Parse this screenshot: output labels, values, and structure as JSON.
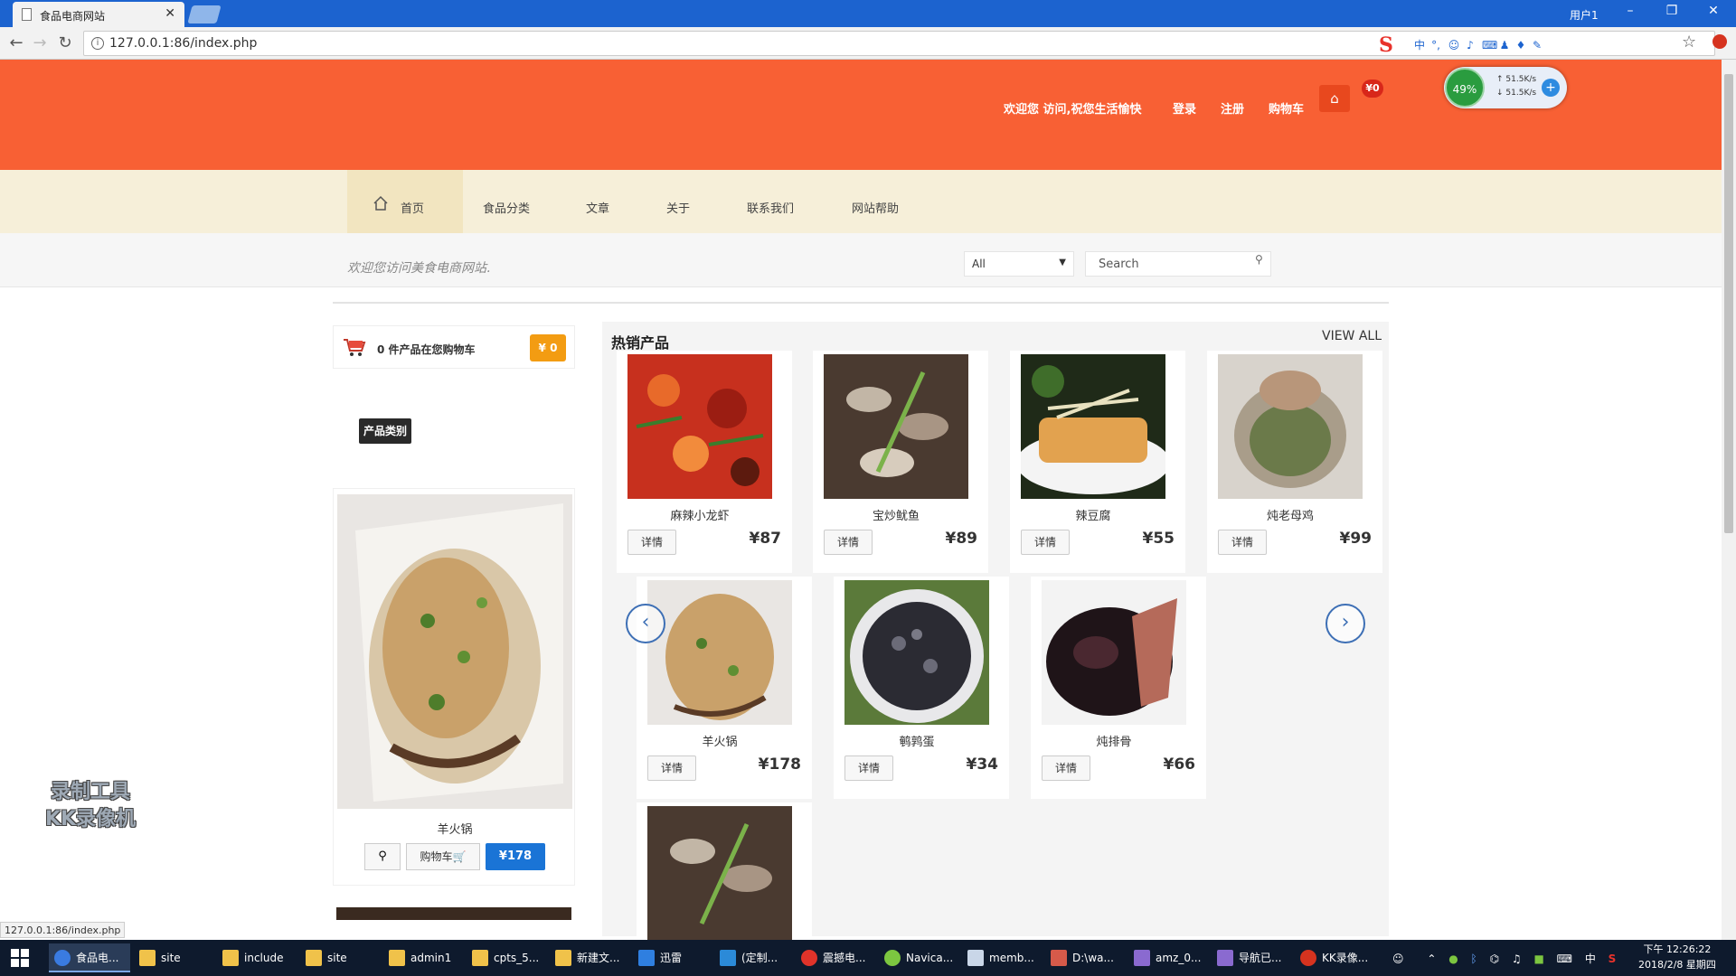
{
  "browser": {
    "tab_title": "食品电商网站",
    "url": "127.0.0.1:86/index.php",
    "window_user": "用户1",
    "status_url": "127.0.0.1:86/index.php"
  },
  "speed_widget": {
    "percent": "49%",
    "upload": "51.5K/s",
    "download": "51.5K/s"
  },
  "header": {
    "welcome": "欢迎您 访问,祝您生活愉快",
    "login": "登录",
    "register": "注册",
    "cart": "购物车",
    "cart_total": "¥0"
  },
  "nav": {
    "items": [
      "首页",
      "食品分类",
      "文章",
      "关于",
      "联系我们",
      "网站帮助"
    ]
  },
  "welcome_strip": {
    "text": "欢迎您访问美食电商网站.",
    "category_value": "All",
    "search_placeholder": "Search"
  },
  "sidebar": {
    "cart_text": "0 件产品在您购物车",
    "cart_price": "¥ 0",
    "category_label": "产品类别",
    "feature": {
      "name": "羊火锅",
      "cart_label": "购物车",
      "price": "¥178"
    }
  },
  "products": {
    "title": "热销产品",
    "view_all": "VIEW ALL",
    "detail_label": "详情",
    "items": [
      {
        "name": "麻辣小龙虾",
        "price": "¥87"
      },
      {
        "name": "宝炒鱿鱼",
        "price": "¥89"
      },
      {
        "name": "辣豆腐",
        "price": "¥55"
      },
      {
        "name": "炖老母鸡",
        "price": "¥99"
      },
      {
        "name": "羊火锅",
        "price": "¥178"
      },
      {
        "name": "鹌鹑蛋",
        "price": "¥34"
      },
      {
        "name": "炖排骨",
        "price": "¥66"
      }
    ]
  },
  "watermark": {
    "line1": "录制工具",
    "line2": "KK录像机"
  },
  "taskbar": {
    "items": [
      "食品电...",
      "site",
      "include",
      "site",
      "admin1",
      "cpts_5...",
      "新建文...",
      "迅雷",
      "(定制...",
      "震撼电...",
      "Navica...",
      "memb...",
      "D:\\wa...",
      "amz_0...",
      "导航已...",
      "KK录像..."
    ],
    "ime": "中",
    "time": "下午 12:26:22",
    "date": "2018/2/8 星期四"
  }
}
